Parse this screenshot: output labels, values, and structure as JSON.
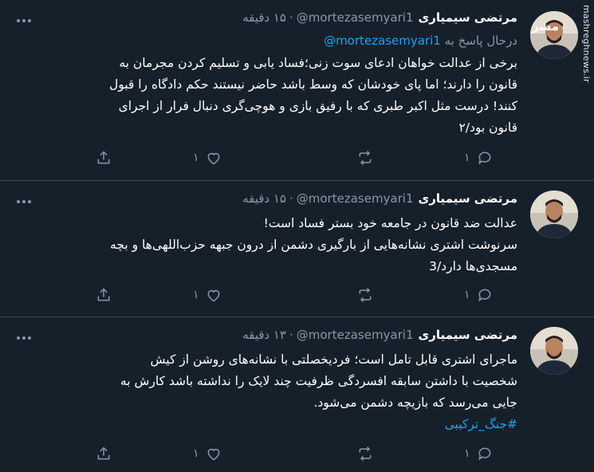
{
  "watermark": {
    "site": "mashreghnews.ir",
    "logo_text": "مشرق"
  },
  "tweets": [
    {
      "author": "مرتضی سیمیاری",
      "handle": "@mortezasemyari1",
      "separator": "·",
      "time": "۱۵ دقیقه",
      "reply_prefix": "درحال پاسخ به",
      "reply_to": "@mortezasemyari1",
      "lines": [
        "برخی از عدالت خواهان ادعای سوت زنی؛فساد یابی و تسلیم کردن مجرمان به",
        "قانون را دارند؛ اما پای خودشان که وسط باشد حاضر نیستند حکم دادگاه را قبول",
        "کنند! درست مثل اکبر طبری که با رفیق بازی و هوچی‌گری دنبال فرار از اجرای",
        "قانون بود/۲"
      ],
      "reply_count": "۱",
      "like_count": "۱"
    },
    {
      "author": "مرتضی سیمیاری",
      "handle": "@mortezasemyari1",
      "separator": "·",
      "time": "۱۵ دقیقه",
      "lines": [
        "عدالت ضد قانون در جامعه خود بستر فساد است!",
        "سرنوشت اشتری نشانه‌هایی از بارگیری دشمن از درون جبهه حزب‌اللهی‌ها و بچه",
        "مسجدی‌ها دارد/3"
      ],
      "reply_count": "۱",
      "like_count": "۱"
    },
    {
      "author": "مرتضی سیمیاری",
      "handle": "@mortezasemyari1",
      "separator": "·",
      "time": "۱۳ دقیقه",
      "lines": [
        "ماجرای اشتری قابل تامل است؛ فردیخصلتی با نشانه‌های روشن از کیش",
        "شخصیت با داشتن سابقه افسردگی ظرفیت چند لایک را نداشته باشد کارش به",
        "جایی می‌رسد که بازیچه دشمن می‌شود."
      ],
      "hashtag": "#جنگ_ترکیبی",
      "reply_count": "۱",
      "like_count": "۱"
    }
  ],
  "colors": {
    "background": "#15202b",
    "divider": "#38444d",
    "text": "#ffffff",
    "secondary": "#8899a6",
    "link": "#1da1f2"
  },
  "icons": [
    "more-icon",
    "share-icon",
    "like-icon",
    "retweet-icon",
    "reply-icon"
  ]
}
